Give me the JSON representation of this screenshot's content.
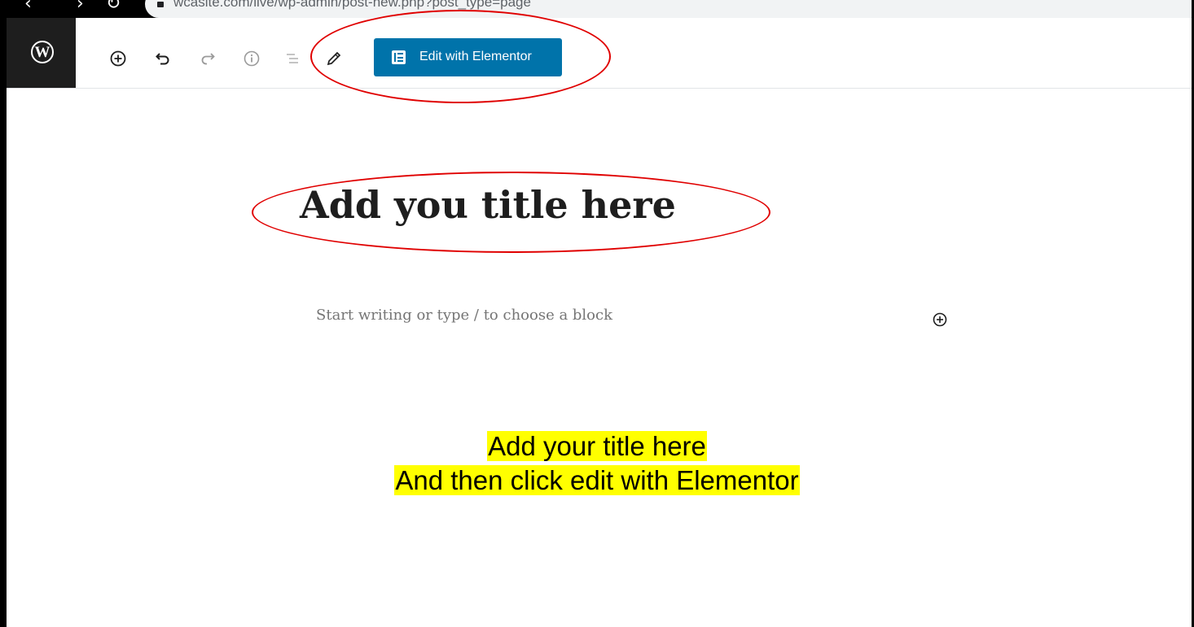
{
  "browser": {
    "url": "wcasite.com/live/wp-admin/post-new.php?post_type=page",
    "back_glyph": "‹",
    "forward_glyph": "›",
    "reload_glyph": "↻"
  },
  "editor": {
    "logo_letter": "W",
    "toolbar": {
      "icons": [
        "add-block-icon",
        "undo-icon",
        "redo-icon",
        "info-icon",
        "list-view-icon",
        "edit-pencil-icon"
      ],
      "elementor_label": "Edit with Elementor"
    },
    "title": "Add you title here",
    "block_placeholder": "Start writing or type / to choose a block"
  },
  "caption": {
    "line1": "Add your title here",
    "line2": "And then click edit with Elementor"
  },
  "colors": {
    "wp_blue": "#0073aa",
    "annotation_red": "#e00000",
    "highlight_yellow": "#ffff00",
    "header_dark": "#1e1e1e"
  }
}
